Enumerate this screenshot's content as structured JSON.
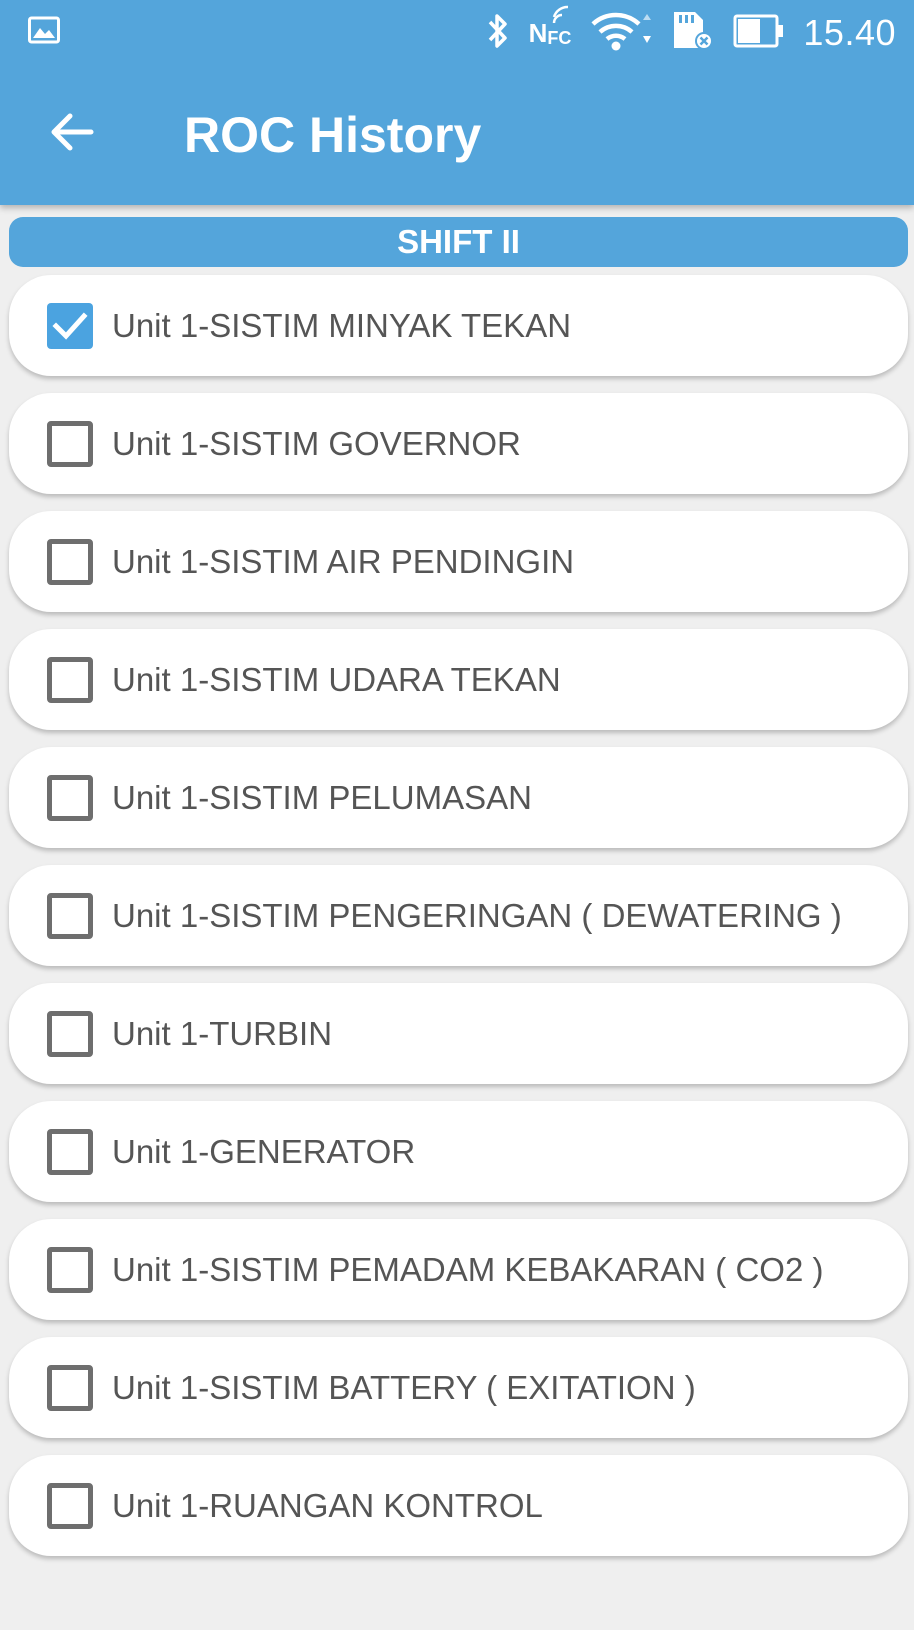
{
  "status_bar": {
    "time": "15.40",
    "nfc_label": "N",
    "nfc_sub": "FC",
    "icons": [
      "image-icon",
      "bluetooth-icon",
      "nfc-icon",
      "wifi-icon",
      "sd-card-icon",
      "battery-icon"
    ]
  },
  "app_bar": {
    "title": "ROC History",
    "back_icon": "arrow-left-icon",
    "color": "#54a5db"
  },
  "shift": {
    "label": "SHIFT II"
  },
  "items": [
    {
      "label": "Unit 1-SISTIM MINYAK TEKAN",
      "checked": true
    },
    {
      "label": "Unit 1-SISTIM GOVERNOR",
      "checked": false
    },
    {
      "label": "Unit 1-SISTIM AIR PENDINGIN",
      "checked": false
    },
    {
      "label": "Unit 1-SISTIM UDARA TEKAN",
      "checked": false
    },
    {
      "label": "Unit 1-SISTIM PELUMASAN",
      "checked": false
    },
    {
      "label": "Unit 1-SISTIM PENGERINGAN ( DEWATERING )",
      "checked": false
    },
    {
      "label": "Unit 1-TURBIN",
      "checked": false
    },
    {
      "label": "Unit 1-GENERATOR",
      "checked": false
    },
    {
      "label": "Unit 1-SISTIM PEMADAM KEBAKARAN ( CO2 )",
      "checked": false
    },
    {
      "label": "Unit 1-SISTIM BATTERY ( EXITATION )",
      "checked": false
    },
    {
      "label": "Unit 1-RUANGAN KONTROL",
      "checked": false
    }
  ]
}
